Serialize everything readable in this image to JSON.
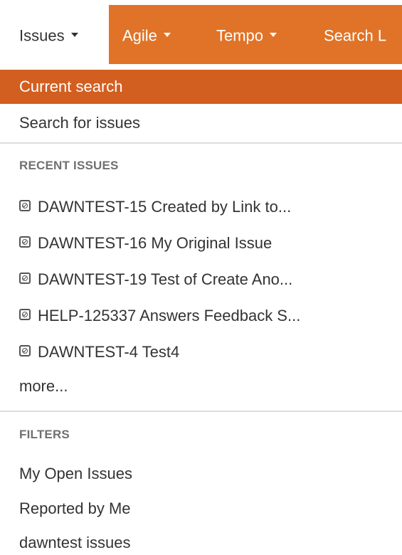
{
  "nav": {
    "items": [
      {
        "label": "Issues",
        "active": true
      },
      {
        "label": "Agile"
      },
      {
        "label": "Tempo"
      },
      {
        "label": "Search L"
      }
    ],
    "bar_color": "#e07327"
  },
  "menu": {
    "current_search": "Current search",
    "search_for_issues": "Search for issues",
    "recent_heading": "RECENT ISSUES",
    "recent": [
      {
        "icon": "issue-type-icon",
        "label": "DAWNTEST-15 Created by Link to..."
      },
      {
        "icon": "issue-type-icon",
        "label": "DAWNTEST-16 My Original Issue"
      },
      {
        "icon": "issue-type-icon",
        "label": "DAWNTEST-19 Test of Create Ano..."
      },
      {
        "icon": "issue-type-icon",
        "label": "HELP-125337 Answers Feedback S..."
      },
      {
        "icon": "issue-type-icon",
        "label": "DAWNTEST-4 Test4"
      }
    ],
    "more_label": "more...",
    "filters_heading": "FILTERS",
    "filters": [
      {
        "label": "My Open Issues"
      },
      {
        "label": "Reported by Me"
      },
      {
        "label": "dawntest issues"
      }
    ],
    "highlight_color": "#d25f20"
  }
}
